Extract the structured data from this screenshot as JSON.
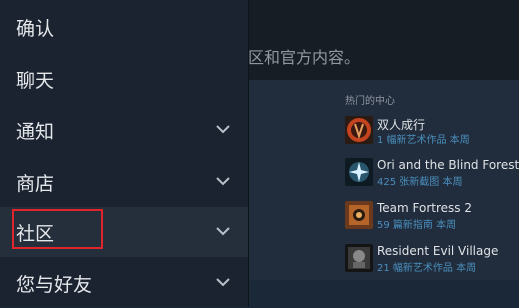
{
  "background": {
    "description": "社区和官方内容。",
    "hub_section_title": "热门的中心",
    "hubs": [
      {
        "name": "双人成行",
        "sub": "1 幅新艺术作品 本周",
        "icon": "it-takes-two-icon"
      },
      {
        "name": "Ori and the Blind Forest: De",
        "sub": "425 张新截图 本周",
        "icon": "ori-icon"
      },
      {
        "name": "Team Fortress 2",
        "sub": "59 篇新指南 本周",
        "icon": "team-fortress-icon"
      },
      {
        "name": "Resident Evil Village",
        "sub": "21 幅新艺术作品 本周",
        "icon": "resident-evil-icon"
      }
    ]
  },
  "menu": {
    "items": [
      {
        "label": "确认",
        "has_chevron": false
      },
      {
        "label": "聊天",
        "has_chevron": false
      },
      {
        "label": "通知",
        "has_chevron": true
      },
      {
        "label": "商店",
        "has_chevron": true
      },
      {
        "label": "社区",
        "has_chevron": true,
        "active": true
      },
      {
        "label": "您与好友",
        "has_chevron": true
      }
    ]
  },
  "colors": {
    "highlight": "#e0252c",
    "link": "#4a8fbc",
    "menu_bg": "#1c2330"
  }
}
